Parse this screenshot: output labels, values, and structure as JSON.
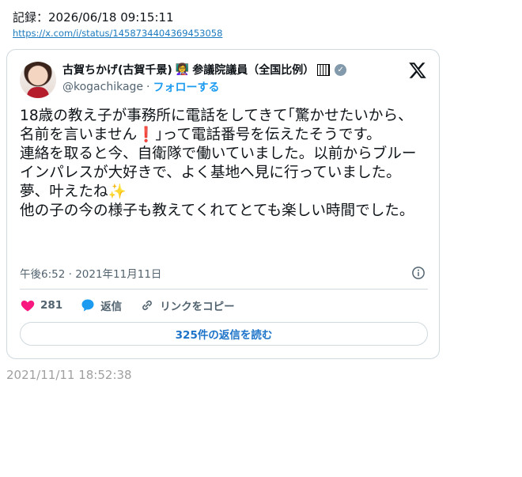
{
  "header": {
    "record_label": "記録：2026/06/18 09:15:11",
    "tweet_url": "https://x.com/i/status/1458734404369453058"
  },
  "tweet": {
    "author_name": "古賀ちかげ(古賀千景)",
    "author_suffix": "参議院議員（全国比例）",
    "handle": "@kogachikage",
    "separator": "·",
    "follow_label": "フォローする",
    "body_lines": [
      "18歳の教え子が事務所に電話をしてきて｢驚かせたいから、名前を言いません",
      "｣って電話番号を伝えたそうです。",
      "連絡を取ると今、自衛隊で働いていました。以前からブルーインパレスが大好きで、よく基地へ見に行っていました。夢、叶えたね",
      "他の子の今の様子も教えてくれてとても楽しい時間でした。"
    ],
    "posted_at": "午後6:52 · 2021年11月11日",
    "likes": "281",
    "reply_label": "返信",
    "copy_link_label": "リンクをコピー",
    "read_replies_label": "325件の返信を読む"
  },
  "footer": {
    "timestamp": "2021/11/11 18:52:38"
  },
  "icons": {
    "like": "heart-icon",
    "reply": "speech-bubble-icon",
    "copy": "link-icon",
    "info": "info-icon",
    "platform": "x-logo-icon"
  },
  "colors": {
    "like": "#f91880",
    "reply": "#1d9bf0",
    "accent": "#1d9bf0"
  }
}
